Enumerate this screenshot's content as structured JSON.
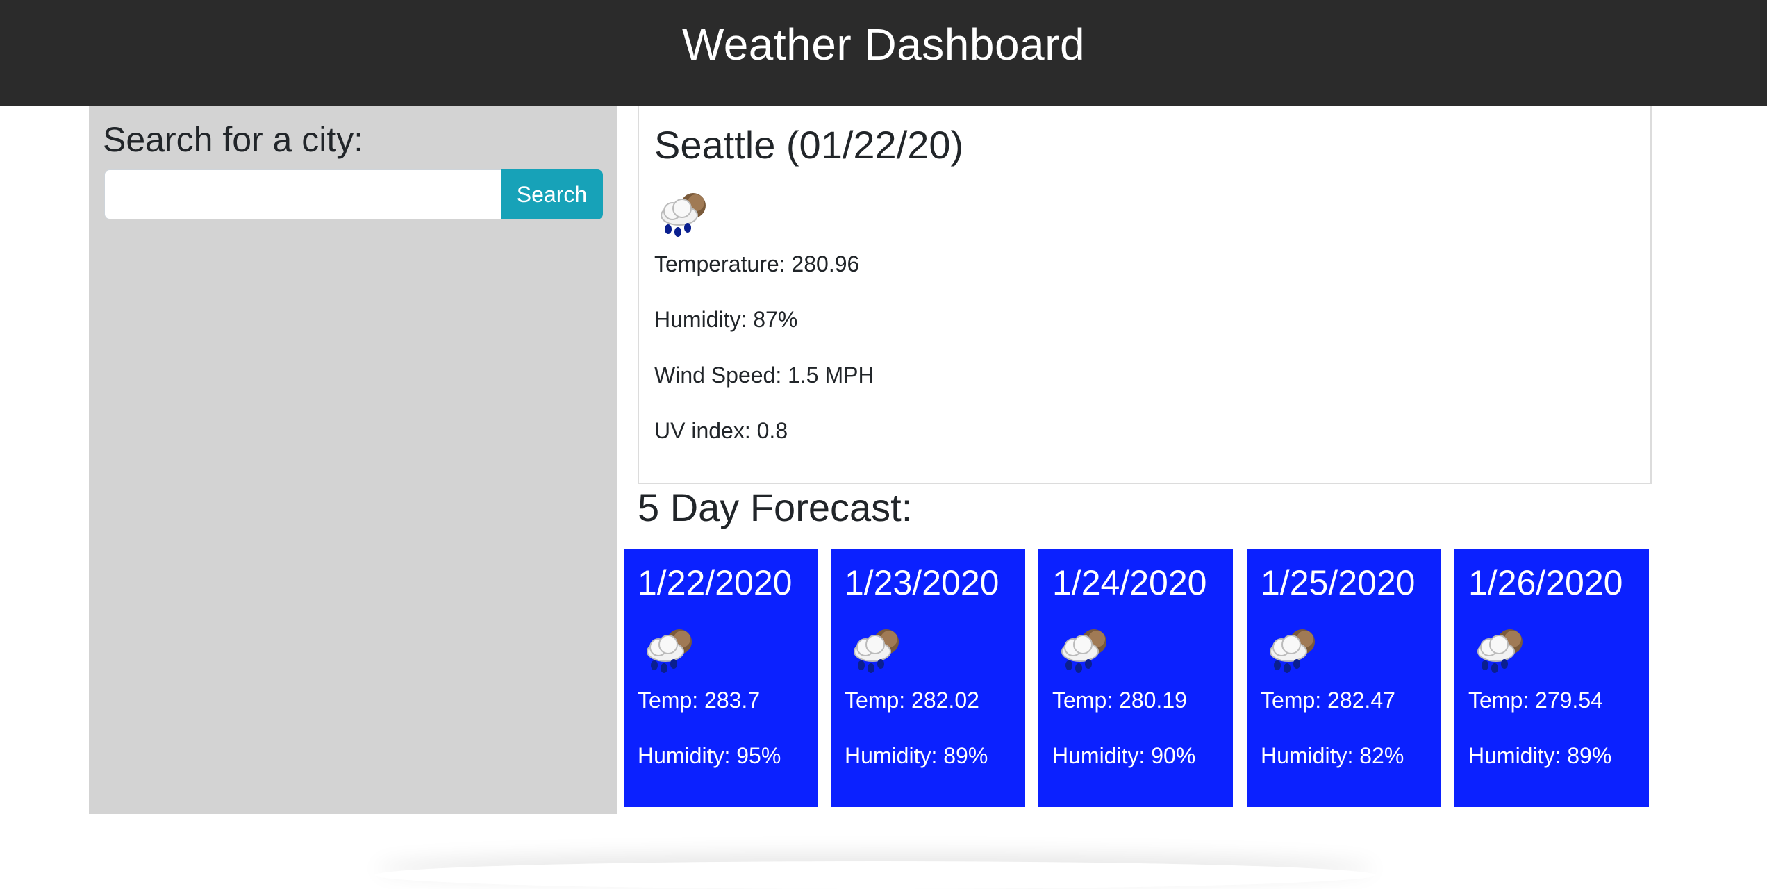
{
  "header": {
    "title": "Weather Dashboard"
  },
  "sidebar": {
    "heading": "Search for a city:",
    "search": {
      "value": "",
      "placeholder": "",
      "button_label": "Search"
    }
  },
  "current": {
    "heading": "Seattle (01/22/20)",
    "icon": "rain-cloud-icon",
    "temperature": "Temperature: 280.96",
    "humidity": "Humidity: 87%",
    "wind": "Wind Speed: 1.5 MPH",
    "uv": "UV index: 0.8"
  },
  "forecast": {
    "title": "5 Day Forecast:",
    "card_color": "#0b21ff",
    "days": [
      {
        "date": "1/22/2020",
        "icon": "rain-cloud-icon",
        "temp": "Temp: 283.7",
        "humidity": "Humidity: 95%"
      },
      {
        "date": "1/23/2020",
        "icon": "rain-cloud-icon",
        "temp": "Temp: 282.02",
        "humidity": "Humidity: 89%"
      },
      {
        "date": "1/24/2020",
        "icon": "rain-cloud-icon",
        "temp": "Temp: 280.19",
        "humidity": "Humidity: 90%"
      },
      {
        "date": "1/25/2020",
        "icon": "rain-cloud-icon",
        "temp": "Temp: 282.47",
        "humidity": "Humidity: 82%"
      },
      {
        "date": "1/26/2020",
        "icon": "rain-cloud-icon",
        "temp": "Temp: 279.54",
        "humidity": "Humidity: 89%"
      }
    ]
  },
  "colors": {
    "header_bg": "#2b2b2b",
    "sidebar_bg": "#d3d3d3",
    "search_button_bg": "#17a2b8"
  }
}
